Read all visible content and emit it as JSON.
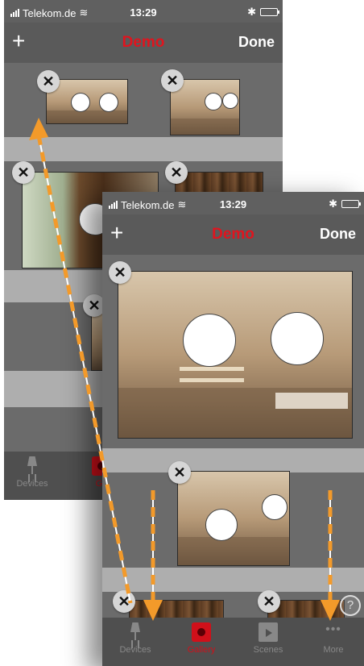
{
  "status_bar": {
    "carrier": "Telekom.de",
    "time": "13:29"
  },
  "nav": {
    "add_label": "+",
    "title": "Demo",
    "done_label": "Done"
  },
  "delete_glyph": "✕",
  "help_glyph": "?",
  "tabs": [
    {
      "label": "Devices",
      "icon": "lamp-icon",
      "active": false
    },
    {
      "label": "Gallery",
      "icon": "gallery-icon",
      "active": true
    },
    {
      "label": "Scenes",
      "icon": "scenes-icon",
      "active": false
    },
    {
      "label": "More",
      "icon": "more-icon",
      "active": false
    }
  ],
  "back_tabs": [
    {
      "label": "Devices"
    },
    {
      "label": "Ga"
    }
  ],
  "colors": {
    "accent": "#e0141e",
    "arrow": "#f39a2a",
    "background": "#606060"
  }
}
